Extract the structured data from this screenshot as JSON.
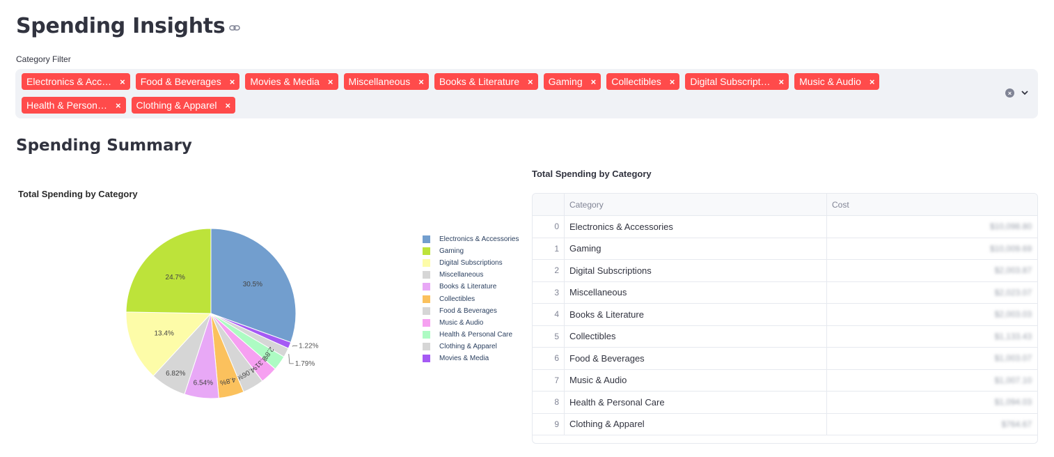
{
  "page": {
    "title": "Spending Insights",
    "filter_label": "Category Filter",
    "chips": [
      "Electronics & Acc…",
      "Food & Beverages",
      "Movies & Media",
      "Miscellaneous",
      "Books & Literature",
      "Gaming",
      "Collectibles",
      "Digital Subscript…",
      "Music & Audio",
      "Health & Person…",
      "Clothing & Apparel"
    ],
    "chip_remove_glyph": "×",
    "clear_glyph": "×",
    "section_title": "Spending Summary"
  },
  "colors": {
    "accent": "#ff4b4b",
    "filter_bg": "#f0f2f6"
  },
  "chart_data": {
    "type": "pie",
    "title": "Total Spending by Category",
    "legend_position": "right",
    "slices": [
      {
        "label": "Electronics & Accessories",
        "value": 30.5,
        "text": "30.5%",
        "color": "#729ece"
      },
      {
        "label": "Movies & Media",
        "value": 1.22,
        "text": "1.22%",
        "color": "#a55af4"
      },
      {
        "label": "Clothing & Apparel",
        "value": 1.79,
        "text": "1.79%",
        "color": "#d6d6d6"
      },
      {
        "label": "Health & Personal Care",
        "value": 2.8,
        "text": "2.8%",
        "color": "#adfbc3"
      },
      {
        "label": "Music & Audio",
        "value": 3.31,
        "text": "3.31%",
        "color": "#f6a0f1"
      },
      {
        "label": "Food & Beverages",
        "value": 4.06,
        "text": "4.06%",
        "color": "#d6d6d6"
      },
      {
        "label": "Collectibles",
        "value": 4.8,
        "text": "4.8%",
        "color": "#fbc15d"
      },
      {
        "label": "Books & Literature",
        "value": 6.54,
        "text": "6.54%",
        "color": "#e8a8f6"
      },
      {
        "label": "Miscellaneous",
        "value": 6.82,
        "text": "6.82%",
        "color": "#d6d6d6"
      },
      {
        "label": "Digital Subscriptions",
        "value": 13.4,
        "text": "13.4%",
        "color": "#fdfca8"
      },
      {
        "label": "Gaming",
        "value": 24.7,
        "text": "24.7%",
        "color": "#bde33a"
      }
    ],
    "legend": [
      {
        "label": "Electronics & Accessories",
        "color": "#729ece"
      },
      {
        "label": "Gaming",
        "color": "#bde33a"
      },
      {
        "label": "Digital Subscriptions",
        "color": "#fdfca8"
      },
      {
        "label": "Miscellaneous",
        "color": "#d6d6d6"
      },
      {
        "label": "Books & Literature",
        "color": "#e8a8f6"
      },
      {
        "label": "Collectibles",
        "color": "#fbc15d"
      },
      {
        "label": "Food & Beverages",
        "color": "#d6d6d6"
      },
      {
        "label": "Music & Audio",
        "color": "#f6a0f1"
      },
      {
        "label": "Health & Personal Care",
        "color": "#adfbc3"
      },
      {
        "label": "Clothing & Apparel",
        "color": "#d6d6d6"
      },
      {
        "label": "Movies & Media",
        "color": "#a55af4"
      }
    ]
  },
  "table": {
    "title": "Total Spending by Category",
    "columns": [
      "",
      "Category",
      "Cost"
    ],
    "rows": [
      {
        "idx": "0",
        "category": "Electronics & Accessories",
        "cost": "$10,098.80"
      },
      {
        "idx": "1",
        "category": "Gaming",
        "cost": "$10,009.69"
      },
      {
        "idx": "2",
        "category": "Digital Subscriptions",
        "cost": "$2,003.87"
      },
      {
        "idx": "3",
        "category": "Miscellaneous",
        "cost": "$2,023.07"
      },
      {
        "idx": "4",
        "category": "Books & Literature",
        "cost": "$2,003.03"
      },
      {
        "idx": "5",
        "category": "Collectibles",
        "cost": "$1,133.43"
      },
      {
        "idx": "6",
        "category": "Food & Beverages",
        "cost": "$1,003.07"
      },
      {
        "idx": "7",
        "category": "Music & Audio",
        "cost": "$1,007.10"
      },
      {
        "idx": "8",
        "category": "Health & Personal Care",
        "cost": "$1,094.03"
      },
      {
        "idx": "9",
        "category": "Clothing & Apparel",
        "cost": "$764.67"
      }
    ]
  }
}
